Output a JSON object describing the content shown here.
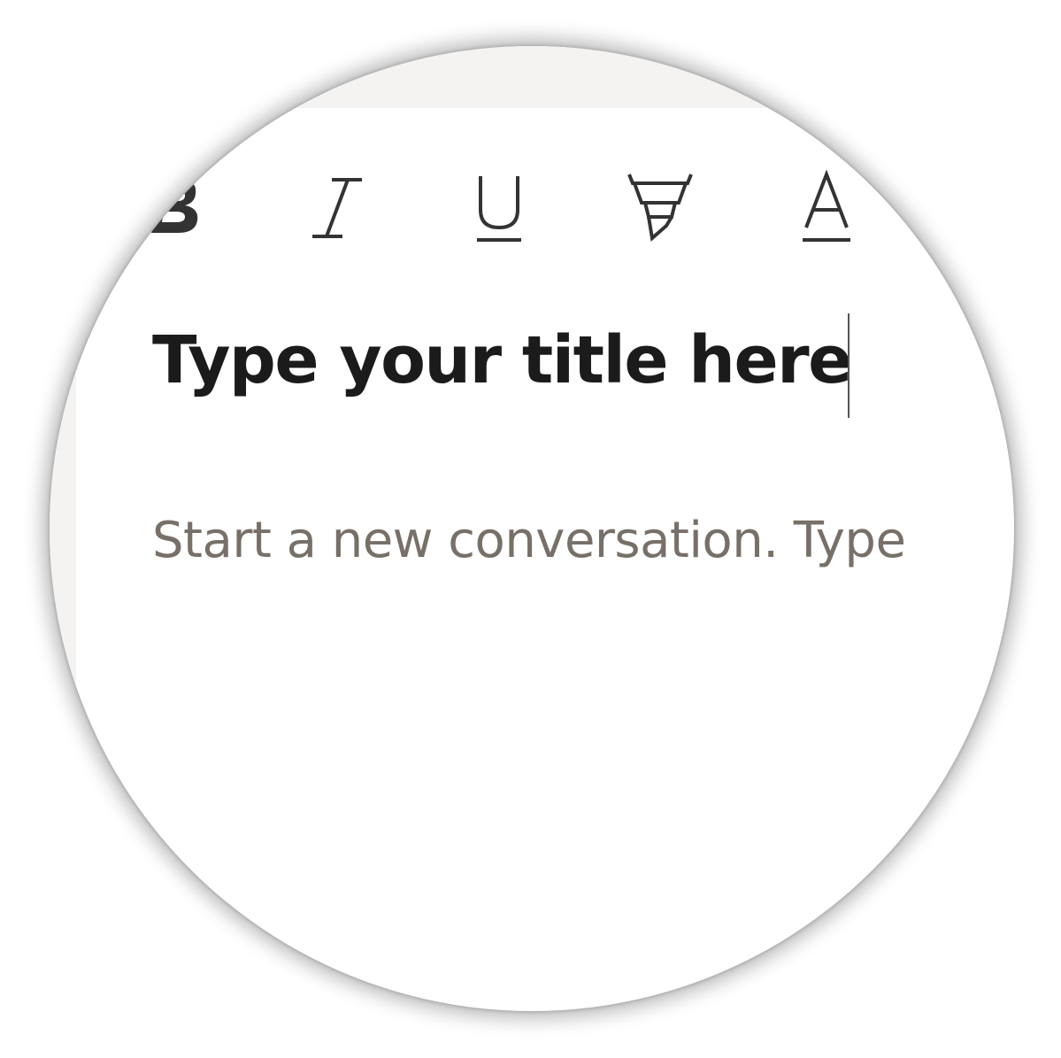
{
  "toolbar": {
    "buttons": [
      {
        "name": "bold",
        "icon": "bold-icon"
      },
      {
        "name": "italic",
        "icon": "italic-icon"
      },
      {
        "name": "underline",
        "icon": "underline-icon"
      },
      {
        "name": "highlight",
        "icon": "highlighter-icon"
      },
      {
        "name": "font-color",
        "icon": "font-color-icon"
      }
    ]
  },
  "editor": {
    "title_value": "Type your title here",
    "body_placeholder": "Start a new conversation. Type"
  },
  "colors": {
    "background": "#ffffff",
    "chrome": "#f4f3f1",
    "title_text": "#1b1b1b",
    "placeholder_text": "#777069",
    "icon": "#333333"
  }
}
